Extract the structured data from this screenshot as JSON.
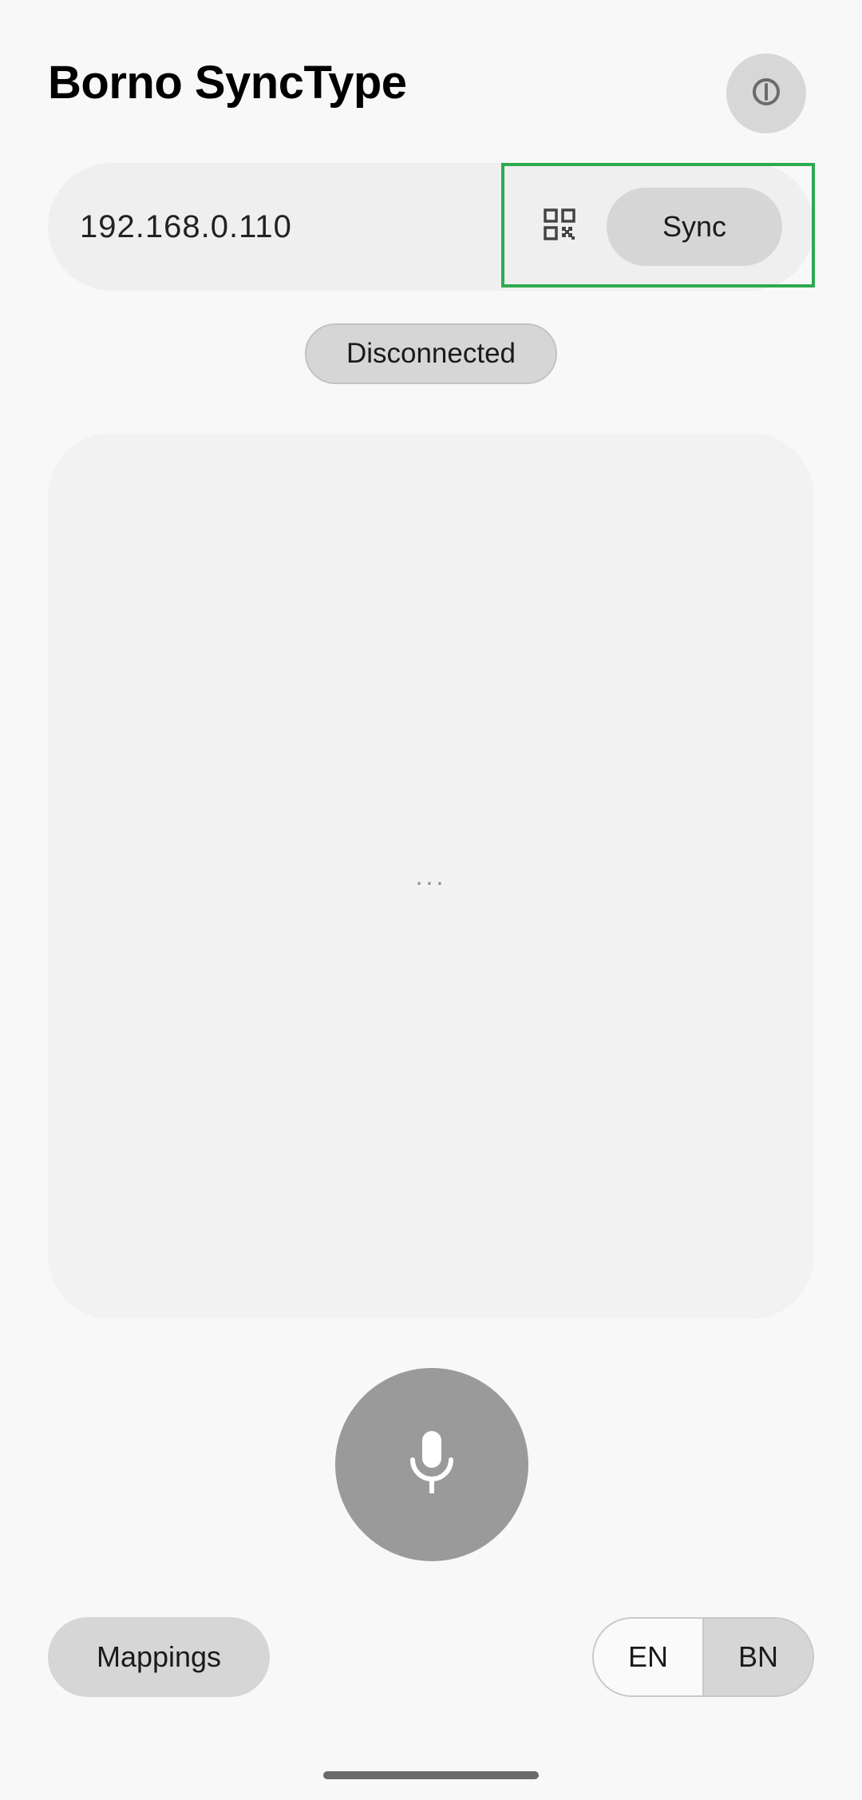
{
  "app": {
    "title": "Borno SyncType"
  },
  "header": {
    "power_icon": "power-icon"
  },
  "connection": {
    "ip_value": "192.168.0.110",
    "qr_icon": "qr-code-icon",
    "sync_label": "Sync",
    "status": "Disconnected",
    "highlight_color": "#2daa4f"
  },
  "transcript": {
    "placeholder": "..."
  },
  "mic": {
    "icon": "microphone-icon"
  },
  "footer": {
    "mappings_label": "Mappings",
    "lang_options": [
      "EN",
      "BN"
    ],
    "lang_selected": "BN"
  }
}
